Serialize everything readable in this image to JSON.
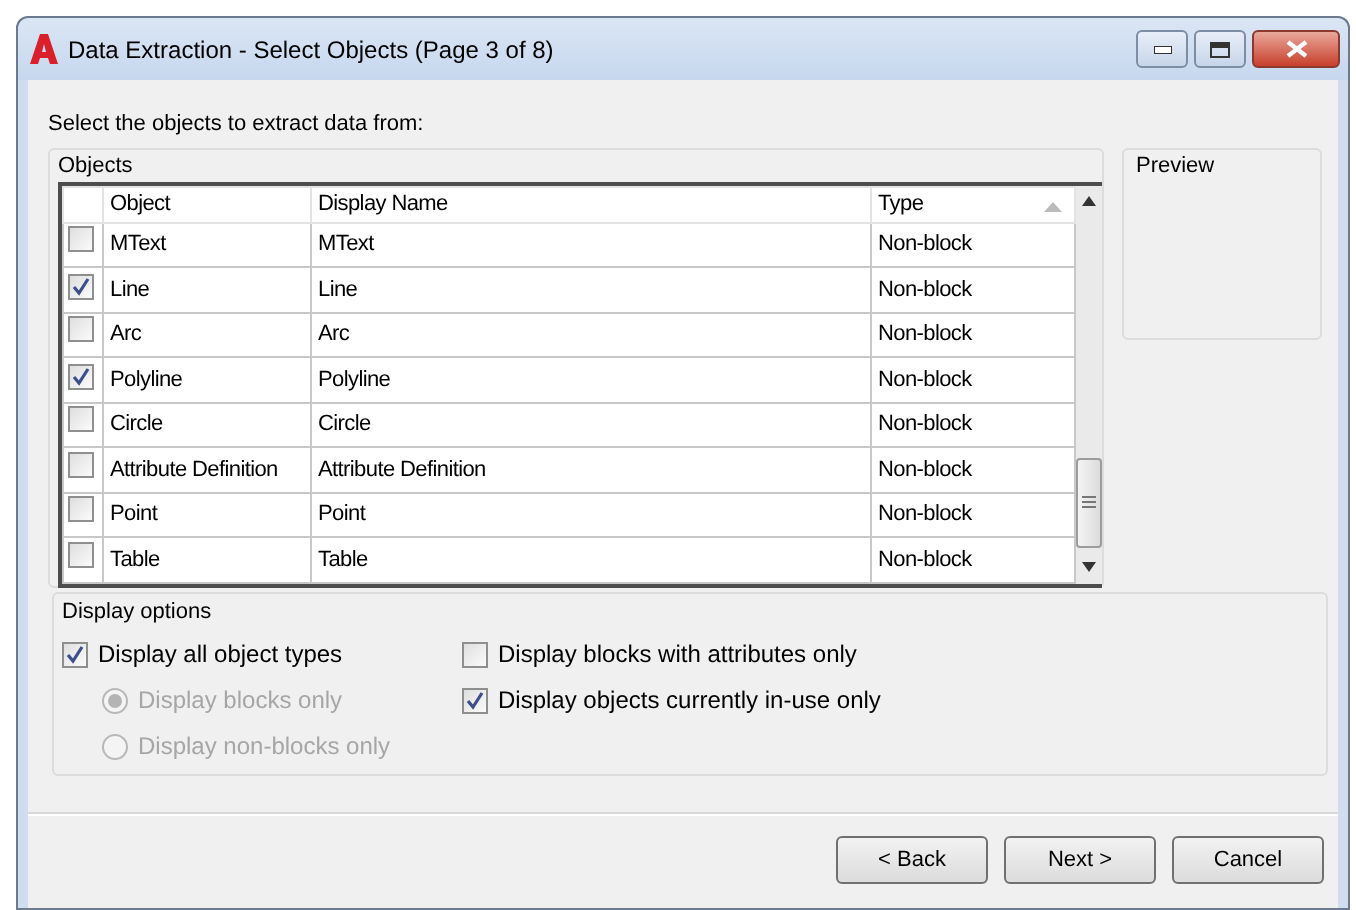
{
  "window": {
    "title": "Data Extraction - Select Objects (Page 3 of 8)"
  },
  "prompt": "Select the objects to extract data from:",
  "objects": {
    "title": "Objects",
    "columns": [
      "Object",
      "Display Name",
      "Type"
    ],
    "rows": [
      {
        "checked": false,
        "object": "MText",
        "display_name": "MText",
        "type": "Non-block"
      },
      {
        "checked": true,
        "object": "Line",
        "display_name": "Line",
        "type": "Non-block"
      },
      {
        "checked": false,
        "object": "Arc",
        "display_name": "Arc",
        "type": "Non-block"
      },
      {
        "checked": true,
        "object": "Polyline",
        "display_name": "Polyline",
        "type": "Non-block"
      },
      {
        "checked": false,
        "object": "Circle",
        "display_name": "Circle",
        "type": "Non-block"
      },
      {
        "checked": false,
        "object": "Attribute Definition",
        "display_name": "Attribute Definition",
        "type": "Non-block"
      },
      {
        "checked": false,
        "object": "Point",
        "display_name": "Point",
        "type": "Non-block"
      },
      {
        "checked": false,
        "object": "Table",
        "display_name": "Table",
        "type": "Non-block"
      }
    ]
  },
  "preview": {
    "title": "Preview"
  },
  "display_options": {
    "title": "Display options",
    "left_options": [
      {
        "kind": "checkbox",
        "label": "Display all object types",
        "checked": true,
        "disabled": false
      },
      {
        "kind": "radio",
        "label": "Display blocks only",
        "selected": true,
        "disabled": true
      },
      {
        "kind": "radio",
        "label": "Display non-blocks only",
        "selected": false,
        "disabled": true
      }
    ],
    "right_options": [
      {
        "kind": "checkbox",
        "label": "Display blocks with attributes only",
        "checked": false,
        "disabled": false
      },
      {
        "kind": "checkbox",
        "label": "Display objects currently in-use only",
        "checked": true,
        "disabled": false
      }
    ]
  },
  "buttons": [
    "< Back",
    "Next >",
    "Cancel"
  ]
}
